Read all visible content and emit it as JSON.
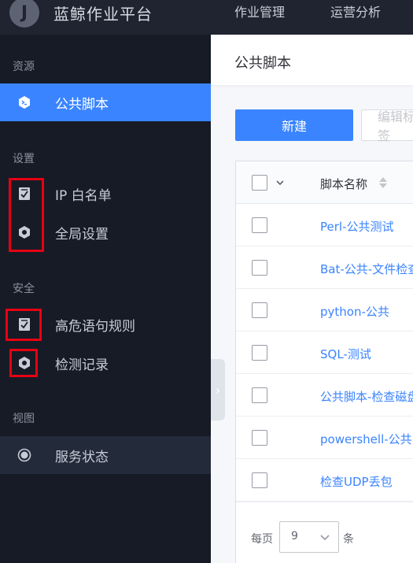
{
  "app": {
    "logo_letter": "J",
    "title": "蓝鲸作业平台"
  },
  "topnav": [
    {
      "label": "作业管理"
    },
    {
      "label": "运营分析"
    }
  ],
  "sidebar": {
    "groups": [
      {
        "title": "资源"
      },
      {
        "title": "设置"
      },
      {
        "title": "安全"
      },
      {
        "title": "视图"
      }
    ],
    "items": [
      {
        "label": "公共脚本",
        "icon": "script-icon",
        "active": true
      },
      {
        "label": "IP 白名单",
        "icon": "checklist-icon"
      },
      {
        "label": "全局设置",
        "icon": "gear-icon"
      },
      {
        "label": "高危语句规则",
        "icon": "checklist-icon"
      },
      {
        "label": "检测记录",
        "icon": "gear-icon"
      },
      {
        "label": "服务状态",
        "icon": "radio-icon"
      }
    ],
    "collapse_glyph": "›"
  },
  "page": {
    "title": "公共脚本"
  },
  "toolbar": {
    "new_label": "新建",
    "edit_label": "编辑标签"
  },
  "table": {
    "columns": {
      "name": "脚本名称"
    },
    "rows": [
      {
        "name": "Perl-公共测试"
      },
      {
        "name": "Bat-公共-文件检查"
      },
      {
        "name": "python-公共"
      },
      {
        "name": "SQL-测试"
      },
      {
        "name": "公共脚本-检查磁盘"
      },
      {
        "name": "powershell-公共"
      },
      {
        "name": "检查UDP丢包"
      }
    ]
  },
  "pagination": {
    "per_page_prefix": "每页",
    "per_page_value": "9",
    "per_page_suffix": "条"
  },
  "colors": {
    "accent": "#3a84ff",
    "sidebar_bg": "#171b26",
    "topbar_bg": "#1f2430",
    "highlight": "#e60012"
  }
}
